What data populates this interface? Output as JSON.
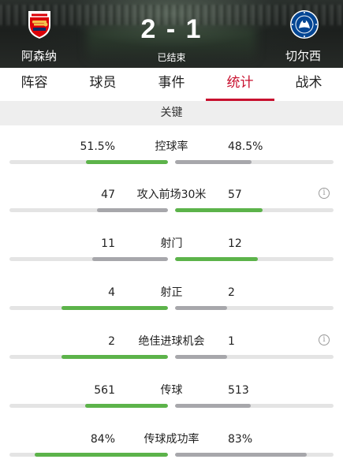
{
  "match": {
    "home_team": "阿森纳",
    "away_team": "切尔西",
    "score": "2 - 1",
    "status": "已结束",
    "home_crest_icon": "arsenal-crest-icon",
    "away_crest_icon": "chelsea-crest-icon"
  },
  "tabs": [
    {
      "label": "阵容",
      "active": false
    },
    {
      "label": "球员",
      "active": false
    },
    {
      "label": "事件",
      "active": false
    },
    {
      "label": "统计",
      "active": true
    },
    {
      "label": "战术",
      "active": false
    }
  ],
  "section": {
    "title": "关键"
  },
  "colors": {
    "accent": "#c8102e",
    "bar_leading": "#5cb34a",
    "bar_trailing": "#a7a7ab",
    "bar_track": "#e4e4e4"
  },
  "stats": [
    {
      "label": "控球率",
      "home": "51.5%",
      "away": "48.5%",
      "home_share": 0.515,
      "away_share": 0.485,
      "info": false
    },
    {
      "label": "攻入前场30米",
      "home": "47",
      "away": "57",
      "home_share": 0.45,
      "away_share": 0.55,
      "info": true
    },
    {
      "label": "射门",
      "home": "11",
      "away": "12",
      "home_share": 0.48,
      "away_share": 0.52,
      "info": false
    },
    {
      "label": "射正",
      "home": "4",
      "away": "2",
      "home_share": 0.67,
      "away_share": 0.33,
      "info": false
    },
    {
      "label": "绝佳进球机会",
      "home": "2",
      "away": "1",
      "home_share": 0.67,
      "away_share": 0.33,
      "info": true
    },
    {
      "label": "传球",
      "home": "561",
      "away": "513",
      "home_share": 0.52,
      "away_share": 0.48,
      "info": false
    },
    {
      "label": "传球成功率",
      "home": "84%",
      "away": "83%",
      "home_share": 0.84,
      "away_share": 0.83,
      "info": false
    }
  ]
}
